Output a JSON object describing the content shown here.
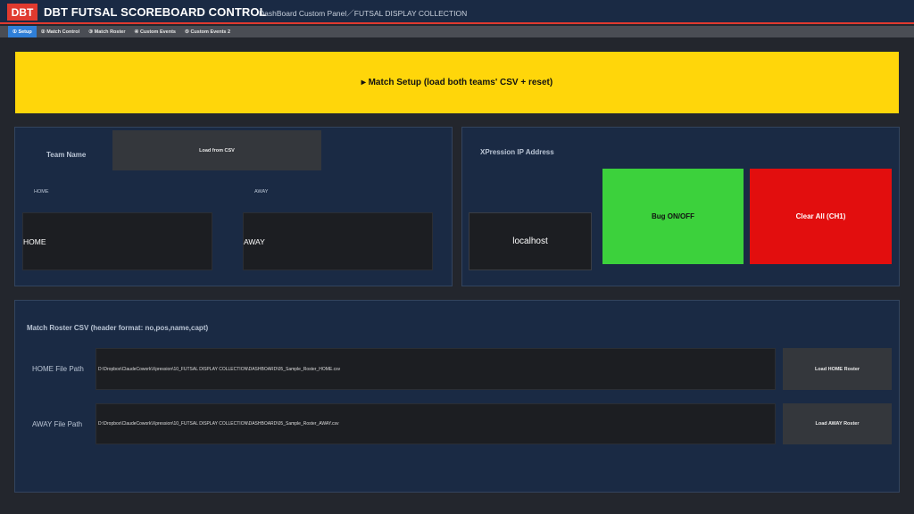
{
  "header": {
    "logo": "DBT",
    "title": "DBT FUTSAL SCOREBOARD CONTROL",
    "subtitle": "DashBoard Custom Panel／FUTSAL DISPLAY COLLECTION"
  },
  "tabs": [
    {
      "label": "① Setup",
      "active": true
    },
    {
      "label": "② Match Control",
      "active": false
    },
    {
      "label": "③ Match Roster",
      "active": false
    },
    {
      "label": "④ Custom Events",
      "active": false
    },
    {
      "label": "⑤ Custom Events 2",
      "active": false
    }
  ],
  "banner": {
    "label": "▸ Match Setup (load both teams' CSV + reset)"
  },
  "team_panel": {
    "team_name_label": "Team Name",
    "load_csv_button": "Load from CSV",
    "home_label": "HOME",
    "away_label": "AWAY",
    "home_value": "HOME",
    "away_value": "AWAY"
  },
  "xpression_panel": {
    "ip_label": "XPression IP Address",
    "ip_value": "localhost",
    "bug_button": "Bug ON/OFF",
    "clear_button": "Clear All (CH1)"
  },
  "roster_panel": {
    "title": "Match Roster CSV (header format: no,pos,name,capt)",
    "home_path_label": "HOME File Path",
    "home_path_value": "D:\\Dropbox\\ClaudeCowork\\Xpression\\10_FUTSAL DISPLAY COLLECTION\\DASHBOARD\\05_Sample_Roster_HOME.csv",
    "home_load_button": "Load HOME Roster",
    "away_path_label": "AWAY File Path",
    "away_path_value": "D:\\Dropbox\\ClaudeCowork\\Xpression\\10_FUTSAL DISPLAY COLLECTION\\DASHBOARD\\05_Sample_Roster_AWAY.csv",
    "away_load_button": "Load AWAY Roster"
  },
  "colors": {
    "accent_red": "#e03a2f",
    "banner_yellow": "#ffd60a",
    "panel_navy": "#1a2a44",
    "tab_active_blue": "#2f7fd8",
    "bug_green": "#3cd13c",
    "clear_red": "#e20e0e"
  }
}
